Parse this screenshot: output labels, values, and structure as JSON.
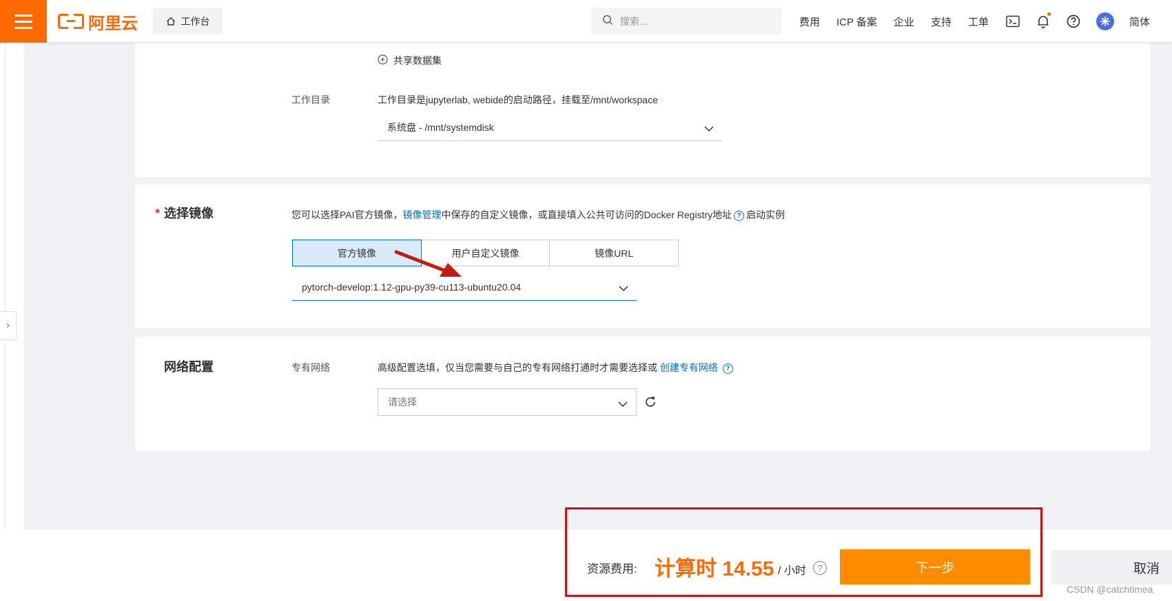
{
  "header": {
    "logo_text": "阿里云",
    "workbench_label": "工作台",
    "search_placeholder": "搜索...",
    "nav_links": [
      "费用",
      "ICP 备案",
      "企业",
      "支持",
      "工单"
    ],
    "lang": "简体"
  },
  "dataset_section": {
    "share_dataset_label": "共享数据集",
    "workdir_label": "工作目录",
    "workdir_desc": "工作目录是jupyterlab, webide的启动路径，挂载至/mnt/workspace",
    "workdir_value": "系统盘 - /mnt/systemdisk"
  },
  "image_section": {
    "title": "选择镜像",
    "required_mark": "*",
    "desc_prefix": "您可以选择PAI官方镜像，",
    "desc_link": "镜像管理",
    "desc_middle": "中保存的自定义镜像，或直接填入公共可访问的Docker Registry地址",
    "desc_suffix": "启动实例",
    "tabs": [
      "官方镜像",
      "用户自定义镜像",
      "镜像URL"
    ],
    "active_tab": 0,
    "image_value": "pytorch-develop:1.12-gpu-py39-cu113-ubuntu20.04"
  },
  "network_section": {
    "title": "网络配置",
    "vpc_label": "专有网络",
    "vpc_desc": "高级配置选填，仅当您需要与自己的专有网络打通时才需要选择或",
    "vpc_link": "创建专有网络",
    "vpc_placeholder": "请选择"
  },
  "footer": {
    "fee_label": "资源费用:",
    "fee_value": "计算时 14.55",
    "fee_unit": "/ 小时",
    "next_label": "下一步",
    "cancel_label": "取消",
    "watermark": "CSDN @catchtimea"
  },
  "colors": {
    "brand_orange": "#ff6a00",
    "button_orange": "#ff8c00",
    "link_blue": "#0070cc",
    "annotation_red": "#cc1111"
  }
}
